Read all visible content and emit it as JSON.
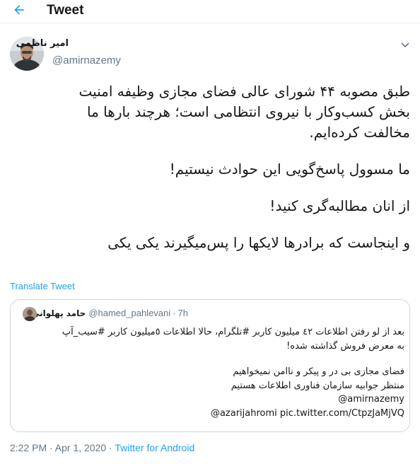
{
  "header": {
    "title": "Tweet",
    "back_icon": "arrow-left-icon",
    "accent_color": "#1da1f2"
  },
  "tweet": {
    "display_name": "امیر ناظمی",
    "username": "@amirnazemy",
    "paragraphs": [
      [
        "طبق مصوبه ۴۴ شورای عالی فضای مجازی وظیفه امنیت",
        "بخش کسب‌وکار با نیروی انتظامی است؛ هرچند بارها ما",
        "مخالفت کرده‌ایم."
      ],
      [
        "ما مسوول پاسخ‌گویی این حوادث نیستیم!"
      ],
      [
        "از انان مطالبه‌گری کنید!"
      ],
      [
        "و اینجاست که برادرها لایکها را پس‌میگیرند یکی یکی"
      ]
    ],
    "translate_label": "Translate Tweet",
    "timestamp": "2:22 PM · Apr 1, 2020",
    "separator": " · ",
    "source": "Twitter for Android"
  },
  "quote": {
    "display_name": "حامد پهلوانی",
    "username": "@hamed_pahlevani",
    "separator": "·",
    "time": "7h",
    "lines": [
      "بعد از لو رفتن اطلاعات ٤٢ میلیون کاربر #تلگرام، حالا اطلاعات ٥میلیون کاربر #سیب_آپ",
      "به معرض فروش گذاشته شده!",
      "",
      "فضای مجازی بی در و پیکر و ناامن نمیخواهیم",
      "منتظر جوابیه سازمان فناوری اطلاعات هستیم",
      "@amirnazemy",
      "@azarijahromi pic.twitter.com/CtpzJaMjVQ"
    ]
  }
}
